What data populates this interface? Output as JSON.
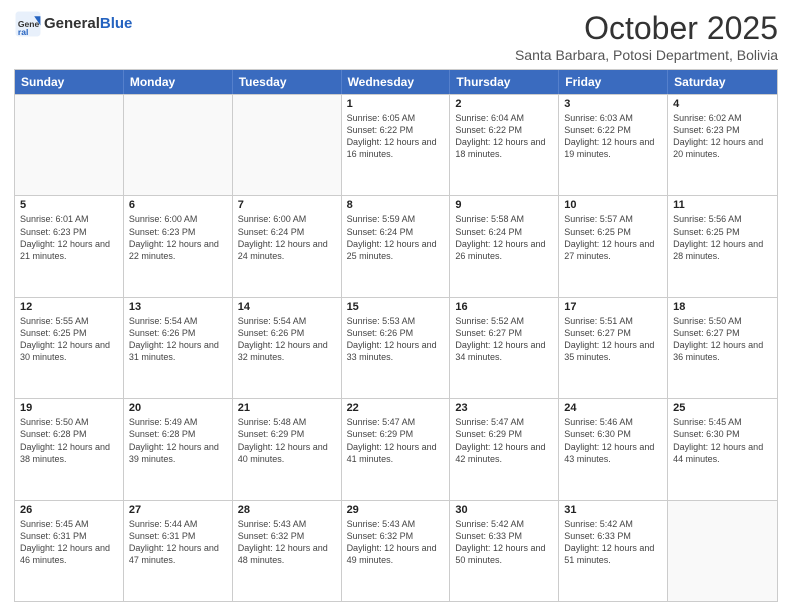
{
  "header": {
    "logo_general": "General",
    "logo_blue": "Blue",
    "month_title": "October 2025",
    "subtitle": "Santa Barbara, Potosi Department, Bolivia"
  },
  "weekdays": [
    "Sunday",
    "Monday",
    "Tuesday",
    "Wednesday",
    "Thursday",
    "Friday",
    "Saturday"
  ],
  "rows": [
    [
      {
        "day": "",
        "info": ""
      },
      {
        "day": "",
        "info": ""
      },
      {
        "day": "",
        "info": ""
      },
      {
        "day": "1",
        "info": "Sunrise: 6:05 AM\nSunset: 6:22 PM\nDaylight: 12 hours and 16 minutes."
      },
      {
        "day": "2",
        "info": "Sunrise: 6:04 AM\nSunset: 6:22 PM\nDaylight: 12 hours and 18 minutes."
      },
      {
        "day": "3",
        "info": "Sunrise: 6:03 AM\nSunset: 6:22 PM\nDaylight: 12 hours and 19 minutes."
      },
      {
        "day": "4",
        "info": "Sunrise: 6:02 AM\nSunset: 6:23 PM\nDaylight: 12 hours and 20 minutes."
      }
    ],
    [
      {
        "day": "5",
        "info": "Sunrise: 6:01 AM\nSunset: 6:23 PM\nDaylight: 12 hours and 21 minutes."
      },
      {
        "day": "6",
        "info": "Sunrise: 6:00 AM\nSunset: 6:23 PM\nDaylight: 12 hours and 22 minutes."
      },
      {
        "day": "7",
        "info": "Sunrise: 6:00 AM\nSunset: 6:24 PM\nDaylight: 12 hours and 24 minutes."
      },
      {
        "day": "8",
        "info": "Sunrise: 5:59 AM\nSunset: 6:24 PM\nDaylight: 12 hours and 25 minutes."
      },
      {
        "day": "9",
        "info": "Sunrise: 5:58 AM\nSunset: 6:24 PM\nDaylight: 12 hours and 26 minutes."
      },
      {
        "day": "10",
        "info": "Sunrise: 5:57 AM\nSunset: 6:25 PM\nDaylight: 12 hours and 27 minutes."
      },
      {
        "day": "11",
        "info": "Sunrise: 5:56 AM\nSunset: 6:25 PM\nDaylight: 12 hours and 28 minutes."
      }
    ],
    [
      {
        "day": "12",
        "info": "Sunrise: 5:55 AM\nSunset: 6:25 PM\nDaylight: 12 hours and 30 minutes."
      },
      {
        "day": "13",
        "info": "Sunrise: 5:54 AM\nSunset: 6:26 PM\nDaylight: 12 hours and 31 minutes."
      },
      {
        "day": "14",
        "info": "Sunrise: 5:54 AM\nSunset: 6:26 PM\nDaylight: 12 hours and 32 minutes."
      },
      {
        "day": "15",
        "info": "Sunrise: 5:53 AM\nSunset: 6:26 PM\nDaylight: 12 hours and 33 minutes."
      },
      {
        "day": "16",
        "info": "Sunrise: 5:52 AM\nSunset: 6:27 PM\nDaylight: 12 hours and 34 minutes."
      },
      {
        "day": "17",
        "info": "Sunrise: 5:51 AM\nSunset: 6:27 PM\nDaylight: 12 hours and 35 minutes."
      },
      {
        "day": "18",
        "info": "Sunrise: 5:50 AM\nSunset: 6:27 PM\nDaylight: 12 hours and 36 minutes."
      }
    ],
    [
      {
        "day": "19",
        "info": "Sunrise: 5:50 AM\nSunset: 6:28 PM\nDaylight: 12 hours and 38 minutes."
      },
      {
        "day": "20",
        "info": "Sunrise: 5:49 AM\nSunset: 6:28 PM\nDaylight: 12 hours and 39 minutes."
      },
      {
        "day": "21",
        "info": "Sunrise: 5:48 AM\nSunset: 6:29 PM\nDaylight: 12 hours and 40 minutes."
      },
      {
        "day": "22",
        "info": "Sunrise: 5:47 AM\nSunset: 6:29 PM\nDaylight: 12 hours and 41 minutes."
      },
      {
        "day": "23",
        "info": "Sunrise: 5:47 AM\nSunset: 6:29 PM\nDaylight: 12 hours and 42 minutes."
      },
      {
        "day": "24",
        "info": "Sunrise: 5:46 AM\nSunset: 6:30 PM\nDaylight: 12 hours and 43 minutes."
      },
      {
        "day": "25",
        "info": "Sunrise: 5:45 AM\nSunset: 6:30 PM\nDaylight: 12 hours and 44 minutes."
      }
    ],
    [
      {
        "day": "26",
        "info": "Sunrise: 5:45 AM\nSunset: 6:31 PM\nDaylight: 12 hours and 46 minutes."
      },
      {
        "day": "27",
        "info": "Sunrise: 5:44 AM\nSunset: 6:31 PM\nDaylight: 12 hours and 47 minutes."
      },
      {
        "day": "28",
        "info": "Sunrise: 5:43 AM\nSunset: 6:32 PM\nDaylight: 12 hours and 48 minutes."
      },
      {
        "day": "29",
        "info": "Sunrise: 5:43 AM\nSunset: 6:32 PM\nDaylight: 12 hours and 49 minutes."
      },
      {
        "day": "30",
        "info": "Sunrise: 5:42 AM\nSunset: 6:33 PM\nDaylight: 12 hours and 50 minutes."
      },
      {
        "day": "31",
        "info": "Sunrise: 5:42 AM\nSunset: 6:33 PM\nDaylight: 12 hours and 51 minutes."
      },
      {
        "day": "",
        "info": ""
      }
    ]
  ]
}
